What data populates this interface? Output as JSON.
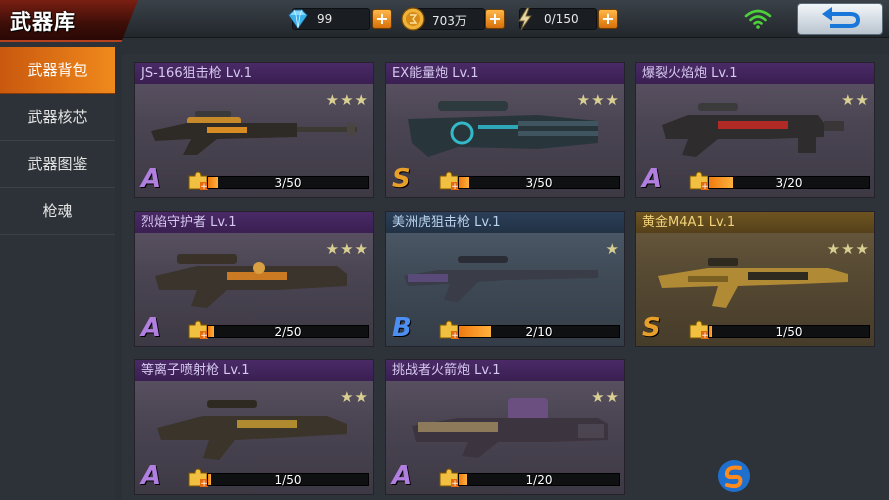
{
  "header": {
    "title": "武器库",
    "diamonds": "99",
    "gold": "703万",
    "energy": "0/150",
    "plus_label": "+"
  },
  "sidebar": {
    "items": [
      {
        "label": "武器背包",
        "active": true
      },
      {
        "label": "武器核芯",
        "active": false
      },
      {
        "label": "武器图鉴",
        "active": false
      },
      {
        "label": "枪魂",
        "active": false
      }
    ]
  },
  "weapons": [
    {
      "name": "JS-166狙击枪  Lv.1",
      "grade": "A",
      "stars": 3,
      "stars_lit": 3,
      "fragments": "3/50",
      "progress": 0.06,
      "theme": "purple"
    },
    {
      "name": "EX能量炮  Lv.1",
      "grade": "S",
      "stars": 3,
      "stars_lit": 3,
      "fragments": "3/50",
      "progress": 0.06,
      "theme": "purple"
    },
    {
      "name": "爆裂火焰炮  Lv.1",
      "grade": "A",
      "stars": 2,
      "stars_lit": 2,
      "fragments": "3/20",
      "progress": 0.15,
      "theme": "purple"
    },
    {
      "name": "烈焰守护者  Lv.1",
      "grade": "A",
      "stars": 3,
      "stars_lit": 3,
      "fragments": "2/50",
      "progress": 0.04,
      "theme": "purple"
    },
    {
      "name": "美洲虎狙击枪  Lv.1",
      "grade": "B",
      "stars": 1,
      "stars_lit": 1,
      "fragments": "2/10",
      "progress": 0.2,
      "theme": "blue"
    },
    {
      "name": "黄金M4A1  Lv.1",
      "grade": "S",
      "stars": 3,
      "stars_lit": 3,
      "fragments": "1/50",
      "progress": 0.02,
      "theme": "gold"
    },
    {
      "name": "等离子喷射枪  Lv.1",
      "grade": "A",
      "stars": 2,
      "stars_lit": 2,
      "fragments": "1/50",
      "progress": 0.02,
      "theme": "purple"
    },
    {
      "name": "挑战者火箭炮  Lv.1",
      "grade": "A",
      "stars": 2,
      "stars_lit": 2,
      "fragments": "1/20",
      "progress": 0.05,
      "theme": "purple"
    }
  ],
  "colors": {
    "accent_orange": "#f08a1c",
    "grade_a": "#b07fe0",
    "grade_s": "#e8a02a",
    "grade_b": "#4c8ef2"
  },
  "icons": {
    "diamond": "diamond-icon",
    "gold": "gold-coin-icon",
    "energy": "lightning-icon",
    "wifi": "wifi-icon",
    "back": "back-arrow-icon",
    "fragment": "fragment-puzzle-icon",
    "star": "star-icon"
  }
}
